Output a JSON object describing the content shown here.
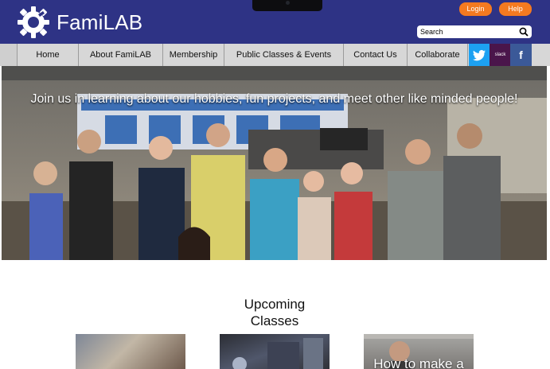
{
  "header": {
    "logo_text": "FamiLAB",
    "login_label": "Login",
    "help_label": "Help",
    "search_placeholder": "Search",
    "background_color": "#2e3385",
    "accent_color": "#f47a20"
  },
  "nav": {
    "items": [
      {
        "label": "Home"
      },
      {
        "label": "About FamiLAB"
      },
      {
        "label": "Membership"
      },
      {
        "label": "Public Classes & Events"
      },
      {
        "label": "Contact Us"
      },
      {
        "label": "Collaborate"
      }
    ],
    "social": [
      {
        "name": "twitter-icon",
        "color": "#1da1f2"
      },
      {
        "name": "slack-icon",
        "label": "slack",
        "color": "#4a154b"
      },
      {
        "name": "facebook-icon",
        "label": "f",
        "color": "#3b5998"
      }
    ]
  },
  "hero": {
    "headline": "Join us in learning about our hobbies, fun projects, and meet other like minded people!"
  },
  "classes": {
    "title": "Upcoming Classes",
    "cards": [
      {
        "caption": ""
      },
      {
        "caption": ""
      },
      {
        "caption": "How to make a"
      }
    ]
  }
}
